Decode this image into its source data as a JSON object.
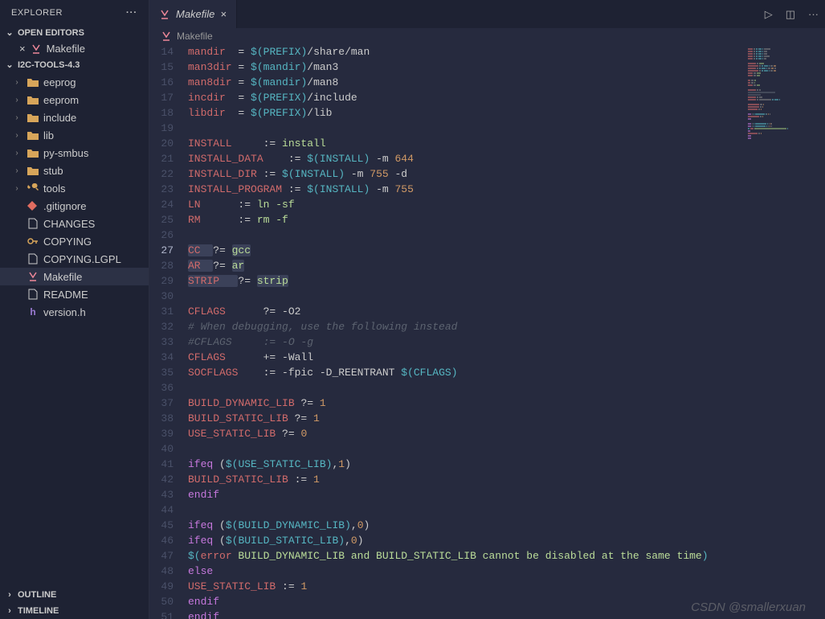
{
  "explorer": {
    "title": "EXPLORER"
  },
  "openEditors": {
    "title": "OPEN EDITORS",
    "items": [
      {
        "name": "Makefile"
      }
    ]
  },
  "project": {
    "title": "I2C-TOOLS-4.3"
  },
  "tree": [
    {
      "type": "folder",
      "name": "eeprog",
      "depth": 1,
      "icon": "folder"
    },
    {
      "type": "folder",
      "name": "eeprom",
      "depth": 1,
      "icon": "folder"
    },
    {
      "type": "folder",
      "name": "include",
      "depth": 1,
      "icon": "folder"
    },
    {
      "type": "folder",
      "name": "lib",
      "depth": 1,
      "icon": "folder"
    },
    {
      "type": "folder",
      "name": "py-smbus",
      "depth": 1,
      "icon": "folder"
    },
    {
      "type": "folder",
      "name": "stub",
      "depth": 1,
      "icon": "folder"
    },
    {
      "type": "folder",
      "name": "tools",
      "depth": 1,
      "icon": "tools"
    },
    {
      "type": "file",
      "name": ".gitignore",
      "depth": 1,
      "icon": "git"
    },
    {
      "type": "file",
      "name": "CHANGES",
      "depth": 1,
      "icon": "doc"
    },
    {
      "type": "file",
      "name": "COPYING",
      "depth": 1,
      "icon": "key"
    },
    {
      "type": "file",
      "name": "COPYING.LGPL",
      "depth": 1,
      "icon": "doc"
    },
    {
      "type": "file",
      "name": "Makefile",
      "depth": 1,
      "icon": "make",
      "active": true
    },
    {
      "type": "file",
      "name": "README",
      "depth": 1,
      "icon": "doc"
    },
    {
      "type": "file",
      "name": "version.h",
      "depth": 1,
      "icon": "h"
    }
  ],
  "panels": {
    "outline": "OUTLINE",
    "timeline": "TIMELINE"
  },
  "tab": {
    "name": "Makefile"
  },
  "breadcrumb": {
    "label": "Makefile"
  },
  "tabActions": {
    "run": "▷",
    "split": "◫",
    "more": "···"
  },
  "currentLine": 27,
  "code": [
    {
      "n": 14,
      "tokens": [
        [
          "mandir  ",
          "var"
        ],
        [
          "= ",
          "assign"
        ],
        [
          "$(",
          "func"
        ],
        [
          "PREFIX",
          "func2"
        ],
        [
          ")",
          "func"
        ],
        [
          "/share/man",
          "path"
        ]
      ]
    },
    {
      "n": 15,
      "tokens": [
        [
          "man3dir ",
          "var"
        ],
        [
          "= ",
          "assign"
        ],
        [
          "$(",
          "func"
        ],
        [
          "mandir",
          "func2"
        ],
        [
          ")",
          "func"
        ],
        [
          "/man3",
          "path"
        ]
      ]
    },
    {
      "n": 16,
      "tokens": [
        [
          "man8dir ",
          "var"
        ],
        [
          "= ",
          "assign"
        ],
        [
          "$(",
          "func"
        ],
        [
          "mandir",
          "func2"
        ],
        [
          ")",
          "func"
        ],
        [
          "/man8",
          "path"
        ]
      ]
    },
    {
      "n": 17,
      "tokens": [
        [
          "incdir  ",
          "var"
        ],
        [
          "= ",
          "assign"
        ],
        [
          "$(",
          "func"
        ],
        [
          "PREFIX",
          "func2"
        ],
        [
          ")",
          "func"
        ],
        [
          "/include",
          "path"
        ]
      ]
    },
    {
      "n": 18,
      "tokens": [
        [
          "libdir  ",
          "var"
        ],
        [
          "= ",
          "assign"
        ],
        [
          "$(",
          "func"
        ],
        [
          "PREFIX",
          "func2"
        ],
        [
          ")",
          "func"
        ],
        [
          "/lib",
          "path"
        ]
      ]
    },
    {
      "n": 19,
      "tokens": []
    },
    {
      "n": 20,
      "tokens": [
        [
          "INSTALL     ",
          "var"
        ],
        [
          ":= ",
          "assign"
        ],
        [
          "install",
          "str"
        ]
      ]
    },
    {
      "n": 21,
      "tokens": [
        [
          "INSTALL_DATA    ",
          "var"
        ],
        [
          ":= ",
          "assign"
        ],
        [
          "$(",
          "func"
        ],
        [
          "INSTALL",
          "func2"
        ],
        [
          ")",
          "func"
        ],
        [
          " -m ",
          "path"
        ],
        [
          "644",
          "num"
        ]
      ]
    },
    {
      "n": 22,
      "tokens": [
        [
          "INSTALL_DIR ",
          "var"
        ],
        [
          ":= ",
          "assign"
        ],
        [
          "$(",
          "func"
        ],
        [
          "INSTALL",
          "func2"
        ],
        [
          ")",
          "func"
        ],
        [
          " -m ",
          "path"
        ],
        [
          "755",
          "num"
        ],
        [
          " -d",
          "path"
        ]
      ]
    },
    {
      "n": 23,
      "tokens": [
        [
          "INSTALL_PROGRAM ",
          "var"
        ],
        [
          ":= ",
          "assign"
        ],
        [
          "$(",
          "func"
        ],
        [
          "INSTALL",
          "func2"
        ],
        [
          ")",
          "func"
        ],
        [
          " -m ",
          "path"
        ],
        [
          "755",
          "num"
        ]
      ]
    },
    {
      "n": 24,
      "tokens": [
        [
          "LN      ",
          "var"
        ],
        [
          ":= ",
          "assign"
        ],
        [
          "ln -sf",
          "str"
        ]
      ]
    },
    {
      "n": 25,
      "tokens": [
        [
          "RM      ",
          "var"
        ],
        [
          ":= ",
          "assign"
        ],
        [
          "rm -f",
          "str"
        ]
      ]
    },
    {
      "n": 26,
      "tokens": []
    },
    {
      "n": 27,
      "tokens": [
        [
          "CC  ",
          "var",
          true
        ],
        [
          "?= ",
          "assign"
        ],
        [
          "gcc",
          "str",
          true
        ]
      ]
    },
    {
      "n": 28,
      "tokens": [
        [
          "AR  ",
          "var",
          true
        ],
        [
          "?= ",
          "assign"
        ],
        [
          "ar",
          "str",
          true
        ]
      ]
    },
    {
      "n": 29,
      "tokens": [
        [
          "STRIP   ",
          "var",
          true
        ],
        [
          "?= ",
          "assign"
        ],
        [
          "strip",
          "str",
          true
        ]
      ]
    },
    {
      "n": 30,
      "tokens": []
    },
    {
      "n": 31,
      "tokens": [
        [
          "CFLAGS      ",
          "var"
        ],
        [
          "?= ",
          "assign"
        ],
        [
          "-O2",
          "path"
        ]
      ]
    },
    {
      "n": 32,
      "tokens": [
        [
          "# When debugging, use the following instead",
          "comment"
        ]
      ]
    },
    {
      "n": 33,
      "tokens": [
        [
          "#CFLAGS     := -O -g",
          "comment"
        ]
      ]
    },
    {
      "n": 34,
      "tokens": [
        [
          "CFLAGS      ",
          "var"
        ],
        [
          "+= ",
          "assign"
        ],
        [
          "-Wall",
          "path"
        ]
      ]
    },
    {
      "n": 35,
      "tokens": [
        [
          "SOCFLAGS    ",
          "var"
        ],
        [
          ":= ",
          "assign"
        ],
        [
          "-fpic -D_REENTRANT ",
          "path"
        ],
        [
          "$(",
          "func"
        ],
        [
          "CFLAGS",
          "func2"
        ],
        [
          ")",
          "func"
        ]
      ]
    },
    {
      "n": 36,
      "tokens": []
    },
    {
      "n": 37,
      "tokens": [
        [
          "BUILD_DYNAMIC_LIB ",
          "var"
        ],
        [
          "?= ",
          "assign"
        ],
        [
          "1",
          "num"
        ]
      ]
    },
    {
      "n": 38,
      "tokens": [
        [
          "BUILD_STATIC_LIB ",
          "var"
        ],
        [
          "?= ",
          "assign"
        ],
        [
          "1",
          "num"
        ]
      ]
    },
    {
      "n": 39,
      "tokens": [
        [
          "USE_STATIC_LIB ",
          "var"
        ],
        [
          "?= ",
          "assign"
        ],
        [
          "0",
          "num"
        ]
      ]
    },
    {
      "n": 40,
      "tokens": []
    },
    {
      "n": 41,
      "tokens": [
        [
          "ifeq ",
          "kw"
        ],
        [
          "(",
          "path"
        ],
        [
          "$(",
          "func"
        ],
        [
          "USE_STATIC_LIB",
          "func2"
        ],
        [
          ")",
          "func"
        ],
        [
          ",",
          "path"
        ],
        [
          "1",
          "num"
        ],
        [
          ")",
          "path"
        ]
      ]
    },
    {
      "n": 42,
      "tokens": [
        [
          "BUILD_STATIC_LIB ",
          "var"
        ],
        [
          ":= ",
          "assign"
        ],
        [
          "1",
          "num"
        ]
      ]
    },
    {
      "n": 43,
      "tokens": [
        [
          "endif",
          "kw"
        ]
      ]
    },
    {
      "n": 44,
      "tokens": []
    },
    {
      "n": 45,
      "tokens": [
        [
          "ifeq ",
          "kw"
        ],
        [
          "(",
          "path"
        ],
        [
          "$(",
          "func"
        ],
        [
          "BUILD_DYNAMIC_LIB",
          "func2"
        ],
        [
          ")",
          "func"
        ],
        [
          ",",
          "path"
        ],
        [
          "0",
          "num"
        ],
        [
          ")",
          "path"
        ]
      ]
    },
    {
      "n": 46,
      "tokens": [
        [
          "ifeq ",
          "kw"
        ],
        [
          "(",
          "path"
        ],
        [
          "$(",
          "func"
        ],
        [
          "BUILD_STATIC_LIB",
          "func2"
        ],
        [
          ")",
          "func"
        ],
        [
          ",",
          "path"
        ],
        [
          "0",
          "num"
        ],
        [
          ")",
          "path"
        ]
      ]
    },
    {
      "n": 47,
      "tokens": [
        [
          "$(",
          "func"
        ],
        [
          "error",
          "var"
        ],
        [
          " BUILD_DYNAMIC_LIB and BUILD_STATIC_LIB cannot be disabled at the same time",
          "str"
        ],
        [
          ")",
          "func"
        ]
      ]
    },
    {
      "n": 48,
      "tokens": [
        [
          "else",
          "kw"
        ]
      ]
    },
    {
      "n": 49,
      "tokens": [
        [
          "USE_STATIC_LIB ",
          "var"
        ],
        [
          ":= ",
          "assign"
        ],
        [
          "1",
          "num"
        ]
      ]
    },
    {
      "n": 50,
      "tokens": [
        [
          "endif",
          "kw"
        ]
      ]
    },
    {
      "n": 51,
      "tokens": [
        [
          "endif",
          "kw"
        ]
      ]
    }
  ],
  "watermark": "CSDN @smallerxuan"
}
